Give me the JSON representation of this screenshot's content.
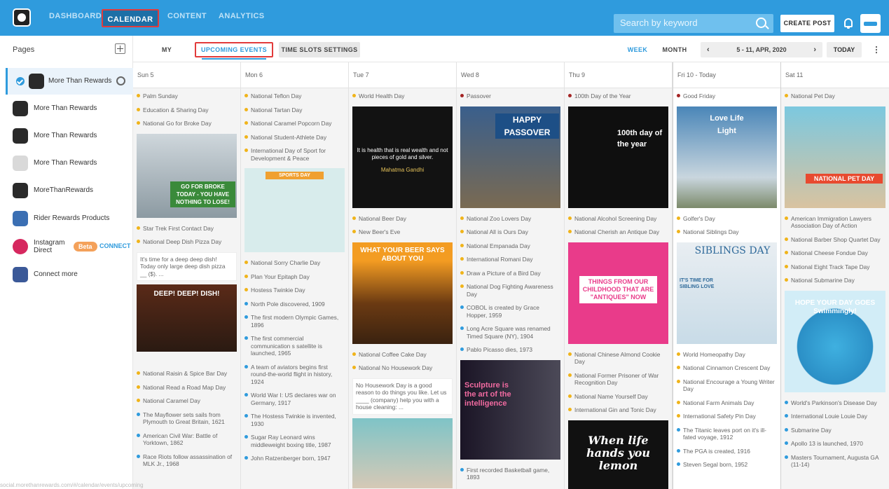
{
  "topnav": {
    "dashboard": "DASHBOARD",
    "calendar": "CALENDAR",
    "content": "CONTENT",
    "analytics": "ANALYTICS",
    "search_placeholder": "Search by keyword",
    "create_post": "CREATE POST"
  },
  "sidebar": {
    "title": "Pages",
    "items": [
      {
        "label": "More Than Rewards"
      },
      {
        "label": "More Than Rewards"
      },
      {
        "label": "More Than Rewards"
      },
      {
        "label": "More Than Rewards"
      },
      {
        "label": "MoreThanRewards"
      },
      {
        "label": "Rider Rewards Products"
      },
      {
        "label": "Instagram Direct",
        "badge": "Beta",
        "action": "CONNECT"
      },
      {
        "label": "Connect more"
      }
    ]
  },
  "subtabs": {
    "my_content": "MY CONTENT",
    "upcoming": "UPCOMING EVENTS",
    "timeslots": "TIME SLOTS SETTINGS",
    "week": "WEEK",
    "month": "MONTH",
    "date_range": "5 - 11, APR, 2020",
    "prev": "‹",
    "next": "›",
    "today": "TODAY"
  },
  "days": [
    {
      "head": "Sun 5",
      "events": [
        "Palm Sunday",
        "Education & Sharing Day",
        "National Go for Broke Day",
        "Star Trek First Contact Day",
        "National Deep Dish Pizza Day",
        "National Raisin & Spice Bar Day",
        "National Read a Road Map Day",
        "National Caramel Day",
        "The Mayflower sets sails from Plymouth to Great Britain, 1621",
        "American Civil War: Battle of Yorktown, 1862",
        "Race Riots follow assassination of MLK Jr., 1968"
      ],
      "img1": "GO FOR BROKE TODAY - YOU HAVE NOTHING TO LOSE!",
      "note": "It's time for a deep deep dish! Today only large deep dish pizza __ ($). ...",
      "img2": "DEEP! DEEP! DISH!"
    },
    {
      "head": "Mon 6",
      "events": [
        "National Teflon Day",
        "National Tartan Day",
        "National Caramel Popcorn Day",
        "National Student-Athlete Day",
        "International Day of Sport for Development & Peace",
        "National Sorry Charlie Day",
        "Plan Your Epitaph Day",
        "Hostess Twinkie Day",
        "North Pole discovered, 1909",
        "The first modern Olympic Games, 1896",
        "The first commercial communication s satellite is launched, 1965",
        "A team of aviators begins first round-the-world flight in history, 1924",
        "World War I: US declares war on Germany, 1917",
        "The Hostess Twinkie is invented, 1930",
        "Sugar Ray Leonard wins middleweight boxing title, 1987",
        "John Ratzenberger born, 1947"
      ],
      "img1": "SPORTS DAY"
    },
    {
      "head": "Tue 7",
      "events": [
        "World Health Day",
        "National Beer Day",
        "New Beer's Eve",
        "National Coffee Cake Day",
        "National No Housework Day"
      ],
      "img1": "It is health that is real wealth and not pieces of gold and silver.",
      "img1b": "Mahatma Gandhi",
      "img2": "WHAT YOUR BEER SAYS ABOUT YOU",
      "note": "No Housework Day is a good reason to do things you like. Let us ____ (company) help you with a house cleaning: ..."
    },
    {
      "head": "Wed 8",
      "events": [
        "Passover",
        "National Zoo Lovers Day",
        "National All is Ours Day",
        "National Empanada Day",
        "International Romani Day",
        "Draw a Picture of a Bird Day",
        "National Dog Fighting Awareness Day",
        "COBOL is created by Grace Hopper, 1959",
        "Long Acre Square was renamed Timed Square (NY), 1904",
        "Pablo Picasso dies, 1973",
        "First recorded Basketball game, 1893"
      ],
      "img1": "HAPPY PASSOVER",
      "img2": "Sculpture is the art of the intelligence"
    },
    {
      "head": "Thu 9",
      "events": [
        "100th Day of the Year",
        "National Alcohol Screening Day",
        "National Cherish an Antique Day",
        "National Chinese Almond Cookie Day",
        "National Former Prisoner of War Recognition Day",
        "National Name Yourself Day",
        "International Gin and Tonic Day"
      ],
      "img1": "100th day of the year",
      "img2": "THINGS FROM OUR CHILDHOOD THAT ARE \"ANTIQUES\" NOW",
      "img3": "When life hands you lemon"
    },
    {
      "head": "Fri 10 - Today",
      "events": [
        "Good Friday",
        "Golfer's Day",
        "National Siblings Day",
        "World Homeopathy Day",
        "National Cinnamon Crescent Day",
        "National Encourage a Young Writer Day",
        "National Farm Animals Day",
        "International Safety Pin Day",
        "The Titanic leaves port on it's ill-fated voyage, 1912",
        "The PGA is created, 1916",
        "Steven Segal born, 1952"
      ],
      "img1": "Love Life Light",
      "img2": "SIBLINGS DAY",
      "img2b": "IT'S TIME FOR SIBLING LOVE"
    },
    {
      "head": "Sat 11",
      "events": [
        "National Pet Day",
        "American Immigration Lawyers Association Day of Action",
        "National Barber Shop Quartet Day",
        "National Cheese Fondue Day",
        "National Eight Track Tape Day",
        "National Submarine Day",
        "World's Parkinson's Disease Day",
        "International Louie Louie Day",
        "Submarine Day",
        "Apollo 13 is launched, 1970",
        "Masters Tournament, Augusta GA (11-14)"
      ],
      "img1": "NATIONAL PET DAY",
      "img2": "HOPE YOUR DAY GOES Swimmingly!"
    }
  ],
  "status": "social.morethanrewards.com/#/calendar/events/upcoming"
}
